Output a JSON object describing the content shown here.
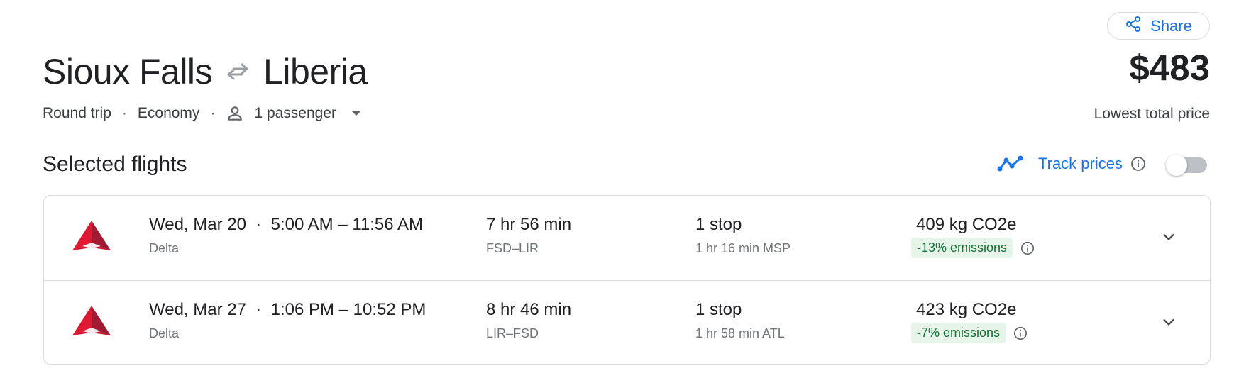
{
  "header": {
    "share_label": "Share",
    "origin": "Sioux Falls",
    "destination": "Liberia",
    "trip_type": "Round trip",
    "cabin": "Economy",
    "passengers": "1 passenger",
    "price": "$483",
    "price_label": "Lowest total price"
  },
  "section": {
    "title": "Selected flights",
    "track_label": "Track prices"
  },
  "flights": [
    {
      "times": "Wed, Mar 20  ·  5:00 AM – 11:56 AM",
      "airline": "Delta",
      "duration": "7 hr 56 min",
      "route": "FSD–LIR",
      "stops": "1 stop",
      "layover": "1 hr 16 min MSP",
      "co2": "409 kg CO2e",
      "emissions": "-13% emissions"
    },
    {
      "times": "Wed, Mar 27  ·  1:06 PM – 10:52 PM",
      "airline": "Delta",
      "duration": "8 hr 46 min",
      "route": "LIR–FSD",
      "stops": "1 stop",
      "layover": "1 hr 58 min ATL",
      "co2": "423 kg CO2e",
      "emissions": "-7% emissions"
    }
  ],
  "colors": {
    "accent": "#1a73e8",
    "text": "#202124",
    "secondary_text": "#70757a",
    "emissions_bg": "#e6f4ea",
    "emissions_text": "#137333",
    "delta_red": "#e01933"
  },
  "icons": {
    "share": "share-icon",
    "swap": "swap-arrows-icon",
    "passenger": "person-icon",
    "dropdown": "caret-down-icon",
    "track": "trending-line-icon",
    "info": "info-icon",
    "expand": "chevron-down-icon",
    "airline_logo": "delta-logo-icon"
  },
  "toggle": {
    "track_prices_on": false
  }
}
